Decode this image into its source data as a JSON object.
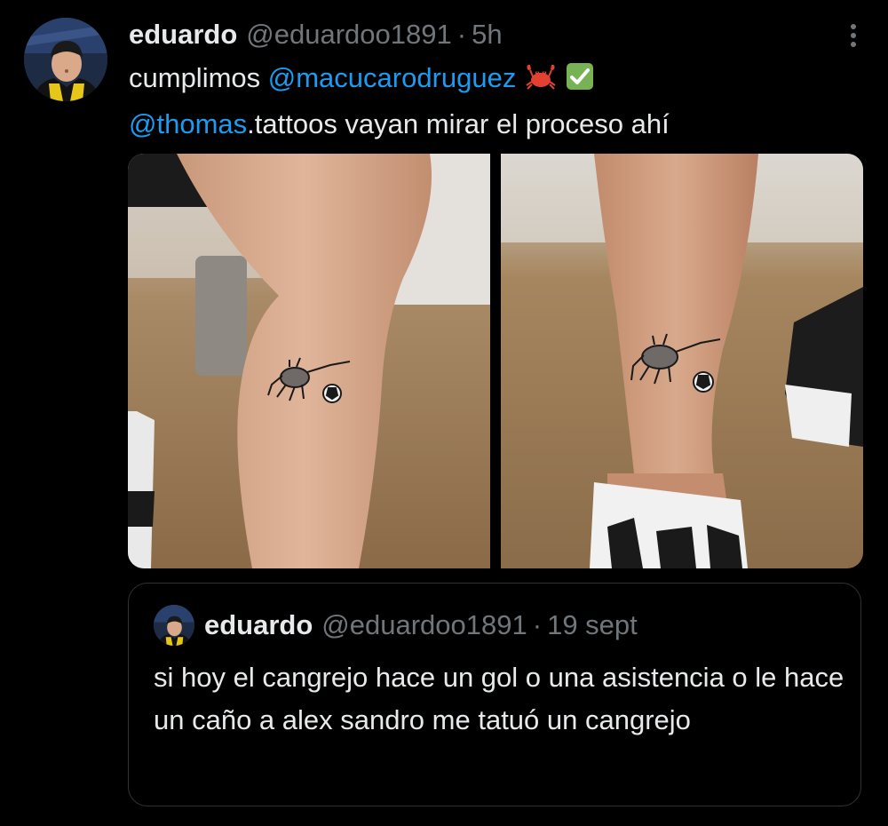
{
  "tweet": {
    "author_name": "eduardo",
    "author_handle": "@eduardoo1891",
    "separator": "·",
    "time": "5h",
    "text_part1": "cumplimos ",
    "mention1": "@macucarodruguez",
    "emojis": [
      "crab-emoji",
      "check-mark-button-emoji"
    ],
    "mention2": "@thomas",
    "text_part2": ".tattoos vayan mirar el proceso ahí",
    "more_icon": "more-vertical-icon"
  },
  "media": {
    "photos": [
      {
        "name": "tattoo-photo-left",
        "description_icon": "crab-tattoo"
      },
      {
        "name": "tattoo-photo-right",
        "description_icon": "crab-tattoo"
      }
    ]
  },
  "quoted_tweet": {
    "author_name": "eduardo",
    "author_handle": "@eduardoo1891",
    "separator": "·",
    "time": "19 sept",
    "text": "si hoy el cangrejo hace un gol o una asistencia o le hace un caño a alex sandro me tatuó un cangrejo"
  },
  "colors": {
    "background": "#000000",
    "text": "#e7e9ea",
    "secondary_text": "#71767b",
    "link": "#1d9bf0",
    "border": "#2f3336"
  }
}
